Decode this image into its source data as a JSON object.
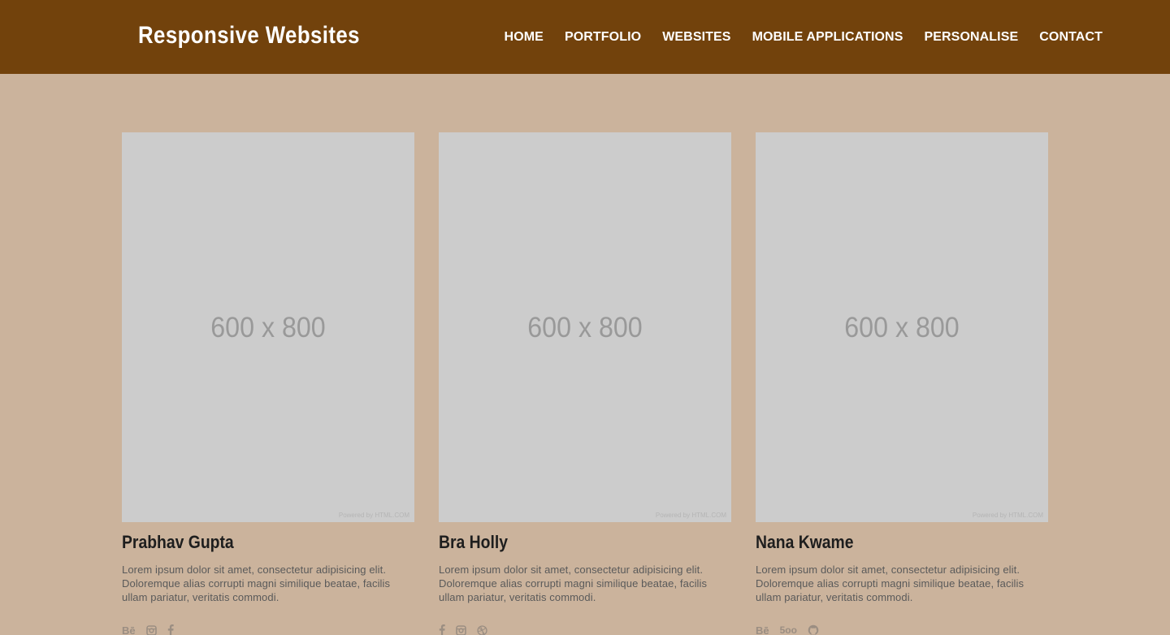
{
  "header": {
    "brand": "Responsive Websites",
    "nav": [
      "HOME",
      "PORTFOLIO",
      "WEBSITES",
      "MOBILE APPLICATIONS",
      "PERSONALISE",
      "CONTACT"
    ]
  },
  "colors": {
    "header_bg": "#72420c",
    "page_bg": "#cbb39c",
    "placeholder_bg": "#cccccc"
  },
  "cards": [
    {
      "image_size": "600 x 800",
      "image_credit": "Powered by HTML.COM",
      "name": "Prabhav Gupta",
      "description": "Lorem ipsum dolor sit amet, consectetur adipisicing elit. Doloremque alias corrupti magni similique beatae, facilis ullam pariatur, veritatis commodi.",
      "socials": [
        "behance-icon",
        "instagram-icon",
        "facebook-icon"
      ]
    },
    {
      "image_size": "600 x 800",
      "image_credit": "Powered by HTML.COM",
      "name": "Bra Holly",
      "description": "Lorem ipsum dolor sit amet, consectetur adipisicing elit. Doloremque alias corrupti magni similique beatae, facilis ullam pariatur, veritatis commodi.",
      "socials": [
        "facebook-icon",
        "instagram-icon",
        "dribbble-icon"
      ]
    },
    {
      "image_size": "600 x 800",
      "image_credit": "Powered by HTML.COM",
      "name": "Nana Kwame",
      "description": "Lorem ipsum dolor sit amet, consectetur adipisicing elit. Doloremque alias corrupti magni similique beatae, facilis ullam pariatur, veritatis commodi.",
      "socials": [
        "behance-icon",
        "500px-icon",
        "github-icon"
      ]
    }
  ]
}
